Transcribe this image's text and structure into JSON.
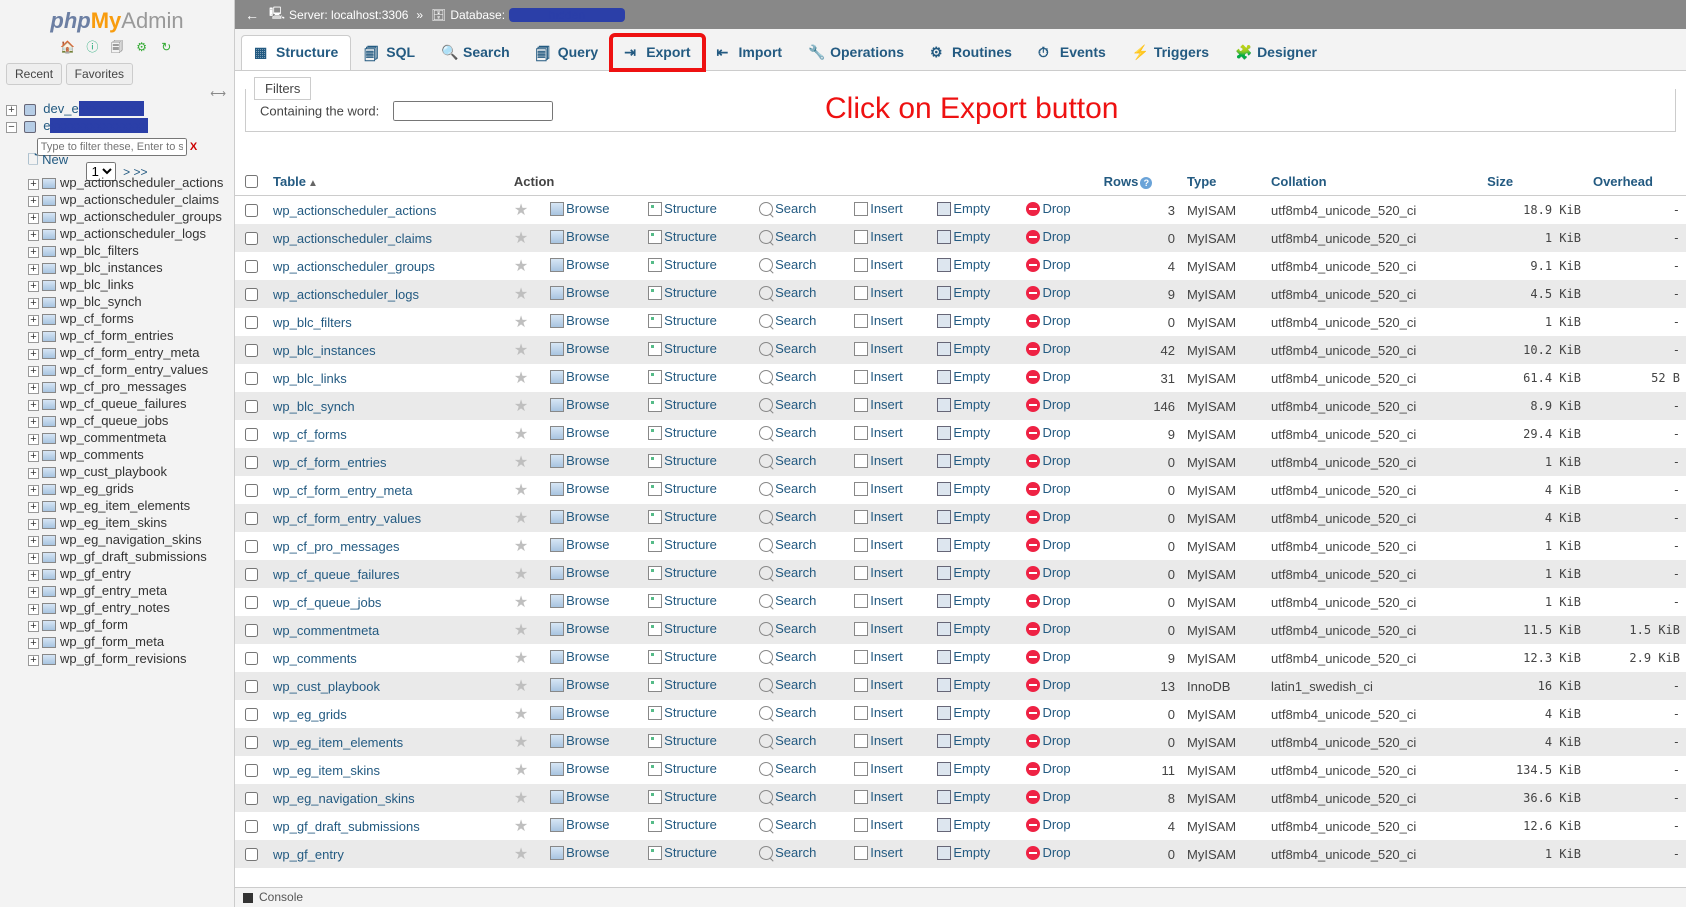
{
  "logo": {
    "php": "php",
    "my": "My",
    "admin": "Admin"
  },
  "sidebar": {
    "quick_icons": [
      "home-icon",
      "help-icon",
      "sql-icon",
      "settings-icon",
      "reload-icon"
    ],
    "recent_label": "Recent",
    "favorites_label": "Favorites",
    "db1": "dev_e",
    "db2": "e",
    "filter_placeholder": "Type to filter these, Enter to search",
    "page_select": "1",
    "pager_more": "> >>",
    "new_label": "New",
    "tables": [
      "wp_actionscheduler_actions",
      "wp_actionscheduler_claims",
      "wp_actionscheduler_groups",
      "wp_actionscheduler_logs",
      "wp_blc_filters",
      "wp_blc_instances",
      "wp_blc_links",
      "wp_blc_synch",
      "wp_cf_forms",
      "wp_cf_form_entries",
      "wp_cf_form_entry_meta",
      "wp_cf_form_entry_values",
      "wp_cf_pro_messages",
      "wp_cf_queue_failures",
      "wp_cf_queue_jobs",
      "wp_commentmeta",
      "wp_comments",
      "wp_cust_playbook",
      "wp_eg_grids",
      "wp_eg_item_elements",
      "wp_eg_item_skins",
      "wp_eg_navigation_skins",
      "wp_gf_draft_submissions",
      "wp_gf_entry",
      "wp_gf_entry_meta",
      "wp_gf_entry_notes",
      "wp_gf_form",
      "wp_gf_form_meta",
      "wp_gf_form_revisions"
    ]
  },
  "breadcrumb": {
    "server_label": "Server: localhost:3306",
    "database_label": "Database:"
  },
  "topmenu": [
    {
      "label": "Structure",
      "icon": "structure-icon"
    },
    {
      "label": "SQL",
      "icon": "sql-icon"
    },
    {
      "label": "Search",
      "icon": "search-icon"
    },
    {
      "label": "Query",
      "icon": "query-icon"
    },
    {
      "label": "Export",
      "icon": "export-icon"
    },
    {
      "label": "Import",
      "icon": "import-icon"
    },
    {
      "label": "Operations",
      "icon": "operations-icon"
    },
    {
      "label": "Routines",
      "icon": "routines-icon"
    },
    {
      "label": "Events",
      "icon": "events-icon"
    },
    {
      "label": "Triggers",
      "icon": "triggers-icon"
    },
    {
      "label": "Designer",
      "icon": "designer-icon"
    }
  ],
  "annotation_text": "Click on Export button",
  "filters": {
    "legend": "Filters",
    "label": "Containing the word:"
  },
  "columns": {
    "table": "Table",
    "action": "Action",
    "rows": "Rows",
    "type": "Type",
    "collation": "Collation",
    "size": "Size",
    "overhead": "Overhead"
  },
  "action_labels": {
    "browse": "Browse",
    "structure": "Structure",
    "search": "Search",
    "insert": "Insert",
    "empty": "Empty",
    "drop": "Drop"
  },
  "rows": [
    {
      "name": "wp_actionscheduler_actions",
      "rows": "3",
      "type": "MyISAM",
      "coll": "utf8mb4_unicode_520_ci",
      "size": "18.9 KiB",
      "over": "-"
    },
    {
      "name": "wp_actionscheduler_claims",
      "rows": "0",
      "type": "MyISAM",
      "coll": "utf8mb4_unicode_520_ci",
      "size": "1 KiB",
      "over": "-"
    },
    {
      "name": "wp_actionscheduler_groups",
      "rows": "4",
      "type": "MyISAM",
      "coll": "utf8mb4_unicode_520_ci",
      "size": "9.1 KiB",
      "over": "-"
    },
    {
      "name": "wp_actionscheduler_logs",
      "rows": "9",
      "type": "MyISAM",
      "coll": "utf8mb4_unicode_520_ci",
      "size": "4.5 KiB",
      "over": "-"
    },
    {
      "name": "wp_blc_filters",
      "rows": "0",
      "type": "MyISAM",
      "coll": "utf8mb4_unicode_520_ci",
      "size": "1 KiB",
      "over": "-"
    },
    {
      "name": "wp_blc_instances",
      "rows": "42",
      "type": "MyISAM",
      "coll": "utf8mb4_unicode_520_ci",
      "size": "10.2 KiB",
      "over": "-"
    },
    {
      "name": "wp_blc_links",
      "rows": "31",
      "type": "MyISAM",
      "coll": "utf8mb4_unicode_520_ci",
      "size": "61.4 KiB",
      "over": "52 B"
    },
    {
      "name": "wp_blc_synch",
      "rows": "146",
      "type": "MyISAM",
      "coll": "utf8mb4_unicode_520_ci",
      "size": "8.9 KiB",
      "over": "-"
    },
    {
      "name": "wp_cf_forms",
      "rows": "9",
      "type": "MyISAM",
      "coll": "utf8mb4_unicode_520_ci",
      "size": "29.4 KiB",
      "over": "-"
    },
    {
      "name": "wp_cf_form_entries",
      "rows": "0",
      "type": "MyISAM",
      "coll": "utf8mb4_unicode_520_ci",
      "size": "1 KiB",
      "over": "-"
    },
    {
      "name": "wp_cf_form_entry_meta",
      "rows": "0",
      "type": "MyISAM",
      "coll": "utf8mb4_unicode_520_ci",
      "size": "4 KiB",
      "over": "-"
    },
    {
      "name": "wp_cf_form_entry_values",
      "rows": "0",
      "type": "MyISAM",
      "coll": "utf8mb4_unicode_520_ci",
      "size": "4 KiB",
      "over": "-"
    },
    {
      "name": "wp_cf_pro_messages",
      "rows": "0",
      "type": "MyISAM",
      "coll": "utf8mb4_unicode_520_ci",
      "size": "1 KiB",
      "over": "-"
    },
    {
      "name": "wp_cf_queue_failures",
      "rows": "0",
      "type": "MyISAM",
      "coll": "utf8mb4_unicode_520_ci",
      "size": "1 KiB",
      "over": "-"
    },
    {
      "name": "wp_cf_queue_jobs",
      "rows": "0",
      "type": "MyISAM",
      "coll": "utf8mb4_unicode_520_ci",
      "size": "1 KiB",
      "over": "-"
    },
    {
      "name": "wp_commentmeta",
      "rows": "0",
      "type": "MyISAM",
      "coll": "utf8mb4_unicode_520_ci",
      "size": "11.5 KiB",
      "over": "1.5 KiB"
    },
    {
      "name": "wp_comments",
      "rows": "9",
      "type": "MyISAM",
      "coll": "utf8mb4_unicode_520_ci",
      "size": "12.3 KiB",
      "over": "2.9 KiB"
    },
    {
      "name": "wp_cust_playbook",
      "rows": "13",
      "type": "InnoDB",
      "coll": "latin1_swedish_ci",
      "size": "16 KiB",
      "over": "-"
    },
    {
      "name": "wp_eg_grids",
      "rows": "0",
      "type": "MyISAM",
      "coll": "utf8mb4_unicode_520_ci",
      "size": "4 KiB",
      "over": "-"
    },
    {
      "name": "wp_eg_item_elements",
      "rows": "0",
      "type": "MyISAM",
      "coll": "utf8mb4_unicode_520_ci",
      "size": "4 KiB",
      "over": "-"
    },
    {
      "name": "wp_eg_item_skins",
      "rows": "11",
      "type": "MyISAM",
      "coll": "utf8mb4_unicode_520_ci",
      "size": "134.5 KiB",
      "over": "-"
    },
    {
      "name": "wp_eg_navigation_skins",
      "rows": "8",
      "type": "MyISAM",
      "coll": "utf8mb4_unicode_520_ci",
      "size": "36.6 KiB",
      "over": "-"
    },
    {
      "name": "wp_gf_draft_submissions",
      "rows": "4",
      "type": "MyISAM",
      "coll": "utf8mb4_unicode_520_ci",
      "size": "12.6 KiB",
      "over": "-"
    },
    {
      "name": "wp_gf_entry",
      "rows": "0",
      "type": "MyISAM",
      "coll": "utf8mb4_unicode_520_ci",
      "size": "1 KiB",
      "over": "-"
    }
  ],
  "console_label": "Console"
}
